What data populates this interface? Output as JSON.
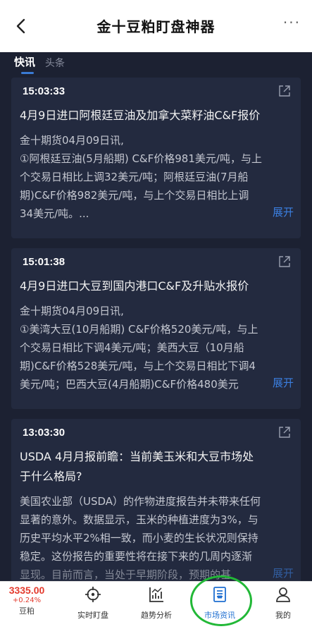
{
  "header": {
    "title": "金十豆粕盯盘神器",
    "more": "···"
  },
  "tabs": [
    {
      "label": "快讯",
      "active": true
    },
    {
      "label": "头条",
      "active": false
    }
  ],
  "feed": [
    {
      "time": "15:03:33",
      "headline": "4月9日进口阿根廷豆油及加拿大菜籽油C&F报价",
      "body_lines": [
        "金十期货04月09日讯,",
        "①阿根廷豆油(5月船期) C&F价格981美元/吨，与上",
        "个交易日相比上调32美元/吨；阿根廷豆油(7月船",
        "期)C&F价格982美元/吨，与上个交易日相比上调",
        "34美元/吨。..."
      ],
      "expand": "展开"
    },
    {
      "time": "15:01:38",
      "headline": "4月9日进口大豆到国内港口C&F及升贴水报价",
      "body_lines": [
        "金十期货04月09日讯,",
        "①美湾大豆(10月船期) C&F价格520美元/吨，与上",
        "个交易日相比下调4美元/吨；美西大豆（10月船",
        "期)C&F价格528美元/吨，与上个交易日相比下调4",
        "美元/吨；巴西大豆(4月船期)C&F价格480美元"
      ],
      "expand": "展开"
    },
    {
      "time": "13:03:30",
      "headline_lines": [
        "USDA 4月月报前瞻：当前美玉米和大豆市场处",
        "于什么格局?"
      ],
      "body_lines": [
        "美国农业部（USDA）的作物进度报告并未带来任何",
        "显著的意外。数据显示，玉米的种植进度为3%，与",
        "历史平均水平2%相一致，而小麦的生长状况则保持",
        "稳定。这份报告的重要性将在接下来的几周内逐渐",
        "显现。目前而言，当处于早期阶段，预期的基"
      ],
      "expand": "展开"
    }
  ],
  "bottom": {
    "price": {
      "value": "3335.00",
      "change": "+0.24%",
      "name": "豆粕"
    },
    "nav": [
      {
        "label": "实时盯盘"
      },
      {
        "label": "趋势分析"
      },
      {
        "label": "市场资讯",
        "active": true
      },
      {
        "label": "我的"
      }
    ]
  },
  "colors": {
    "accent": "#3b7fe0",
    "up": "#e33a2d",
    "background": "#1c2132",
    "card": "#232a3f",
    "highlight": "#22b837"
  }
}
